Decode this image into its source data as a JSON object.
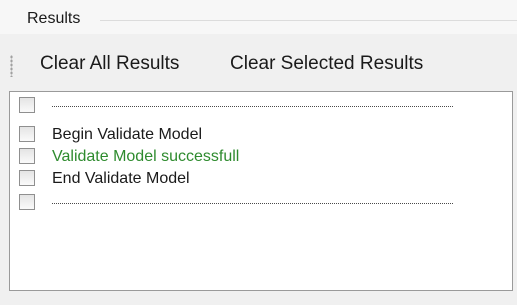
{
  "panel": {
    "title": "Results"
  },
  "toolbar": {
    "clear_all_label": "Clear All Results",
    "clear_selected_label": "Clear Selected Results"
  },
  "results": {
    "rows": [
      {
        "text": "----------------------------------------------------------------",
        "status": "separator",
        "checked": false
      },
      {
        "text": "Begin Validate Model",
        "status": "normal",
        "checked": false
      },
      {
        "text": "Validate Model successfull",
        "status": "success",
        "checked": false
      },
      {
        "text": "End Validate Model",
        "status": "normal",
        "checked": false
      },
      {
        "text": "----------------------------------------------------------------",
        "status": "separator",
        "checked": false
      }
    ]
  },
  "colors": {
    "success_text": "#2e8b2e",
    "normal_text": "#1a1a1a"
  }
}
